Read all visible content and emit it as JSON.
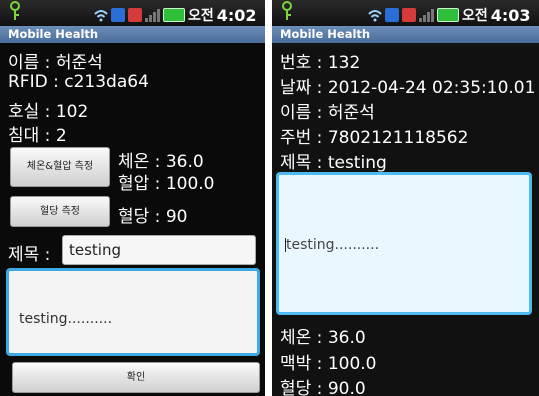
{
  "left": {
    "status": {
      "ampm": "오전",
      "time": "4:02"
    },
    "app_title": "Mobile Health",
    "fields": [
      {
        "label": "이름",
        "value": "허준석"
      },
      {
        "label": "RFID",
        "value": "c213da64"
      },
      {
        "label": "호실",
        "value": "102"
      },
      {
        "label": "침대",
        "value": "2"
      }
    ],
    "measure_temp_bp_button": "체온&혈압 측정",
    "temperature": {
      "label": "체온",
      "value": "36.0"
    },
    "blood_pressure": {
      "label": "혈압",
      "value": "100.0"
    },
    "measure_glucose_button": "혈당 측정",
    "glucose": {
      "label": "혈당",
      "value": "90"
    },
    "subject_label": "제목 :",
    "subject_value": "testing",
    "memo_value": "testing..........",
    "confirm_button": "확인"
  },
  "right": {
    "status": {
      "ampm": "오전",
      "time": "4:03"
    },
    "app_title": "Mobile Health",
    "fields": [
      {
        "label": "번호",
        "value": "132"
      },
      {
        "label": "날짜",
        "value": "2012-04-24 02:35:10.01"
      },
      {
        "label": "이름",
        "value": "허준석"
      },
      {
        "label": "주번",
        "value": "7802121118562"
      },
      {
        "label": "제목",
        "value": "testing"
      }
    ],
    "memo_value": "testing..........",
    "vitals": [
      {
        "label": "체온",
        "value": "36.0"
      },
      {
        "label": "맥박",
        "value": "100.0"
      },
      {
        "label": "혈당",
        "value": "90.0"
      }
    ]
  },
  "colors": {
    "title_bar": "#5b7dab",
    "focus_border": "#3da8e6",
    "battery": "#2fbf3a",
    "key_icon": "#7cd63a"
  },
  "icons": [
    "key-icon",
    "wifi-icon",
    "sync-icon",
    "alert-icon",
    "signal-icon",
    "battery-icon"
  ]
}
